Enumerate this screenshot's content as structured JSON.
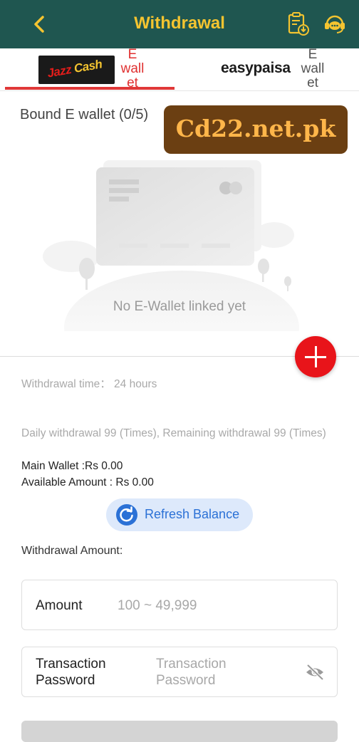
{
  "header": {
    "title": "Withdrawal",
    "back_icon": "chevron-left-icon",
    "records_icon": "clipboard-download-icon",
    "support_icon": "customer-service-icon",
    "accent_color": "#f4c430",
    "bg_color": "#1f5650"
  },
  "tabs": [
    {
      "logo_text_a": "Jazz",
      "logo_text_b": "Cash",
      "label": "E\nwall\net",
      "selected": true
    },
    {
      "logo_text_a": "easy",
      "logo_text_b": "paisa",
      "label": "E\nwall\net",
      "selected": false
    }
  ],
  "bound": {
    "title": "Bound E wallet (0/5)",
    "empty_text": "No E-Wallet linked yet"
  },
  "watermark": "Cd22.net.pk",
  "info": {
    "withdrawal_time": "Withdrawal time：  24 hours",
    "daily_limit": "Daily withdrawal 99 (Times), Remaining withdrawal 99 (Times)",
    "main_wallet": "Main Wallet :Rs 0.00",
    "available_amount": "Available Amount : Rs 0.00"
  },
  "refresh_button": "Refresh Balance",
  "amount_section": {
    "title": "Withdrawal Amount:",
    "amount_label": "Amount",
    "amount_placeholder": "100 ~ 49,999",
    "password_label": "Transaction Password",
    "password_placeholder": "Transaction Password"
  }
}
